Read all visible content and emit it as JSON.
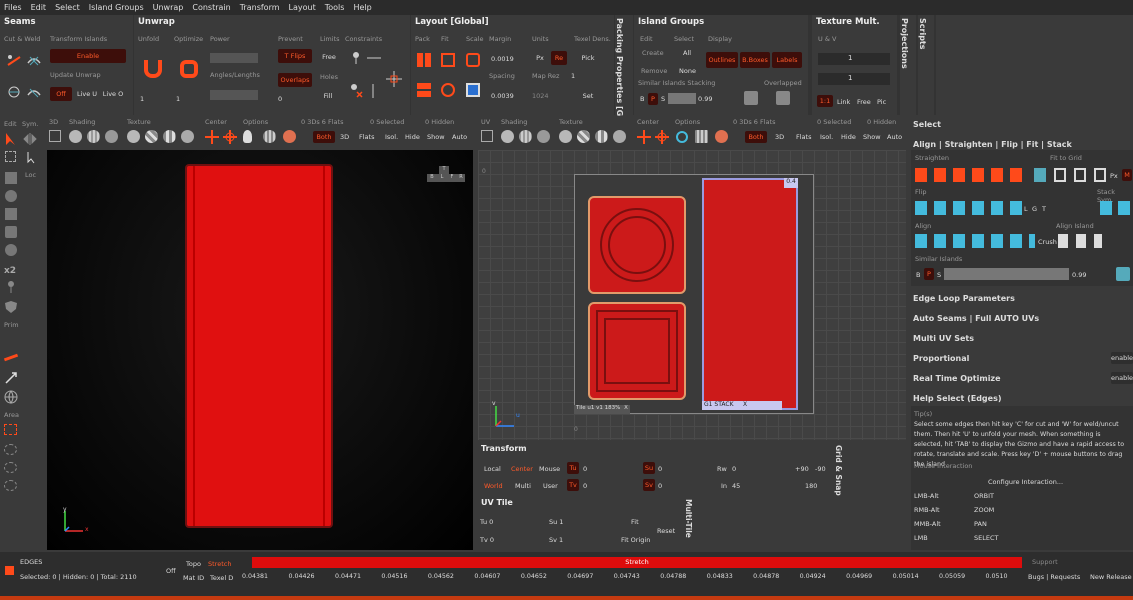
{
  "menu": [
    "Files",
    "Edit",
    "Select",
    "Island Groups",
    "Unwrap",
    "Constrain",
    "Transform",
    "Layout",
    "Tools",
    "Help"
  ],
  "seams": {
    "title": "Seams",
    "cut_weld": "Cut & Weld",
    "sym": "Sym."
  },
  "transform_islands": {
    "label": "Transform Islands",
    "enable": "Enable",
    "update_label": "Update Unwrap",
    "off": "Off",
    "live_u": "Live U",
    "live_o": "Live O"
  },
  "unwrap": {
    "title": "Unwrap",
    "unfold": "Unfold",
    "optimize": "Optimize",
    "power": "Power",
    "prevent": "Prevent",
    "limits": "Limits",
    "constraints": "Constraints",
    "t_flips": "T Flips",
    "free": "Free",
    "angles": "Angles/Lengths",
    "overlaps": "Overlaps",
    "holes": "Holes",
    "fill": "Fill",
    "v1": "1",
    "v2": "1",
    "v3": "0"
  },
  "layout": {
    "title": "Layout [Global]",
    "pack": "Pack",
    "fit": "Fit",
    "scale": "Scale",
    "margin": "Margin",
    "units": "Units",
    "texel": "Texel Dens.",
    "margin_val": "0.0019",
    "px": "Px",
    "re": "Re",
    "pick": "Pick",
    "spacing": "Spacing",
    "map_rez": "Map Rez",
    "spacing_val": "0.0039",
    "map_val": "1024",
    "set": "Set",
    "one": "1"
  },
  "packing_tab": "Packing Properties [Glo",
  "island_groups": {
    "title": "Island Groups",
    "edit": "Edit",
    "select": "Select",
    "display": "Display",
    "create": "Create",
    "all": "All",
    "remove": "Remove",
    "none": "None",
    "outlines": "Outlines",
    "bboxes": "B.Boxes",
    "labels": "Labels",
    "stacking": "Similar Islands Stacking",
    "overlapped": "Overlapped",
    "b": "B",
    "p": "P",
    "s": "S",
    "val": "0.99"
  },
  "texture_mult": {
    "title": "Texture Mult.",
    "uv": "U & V",
    "v1": "1",
    "v2": "1",
    "one": "1:1",
    "link": "Link",
    "free": "Free",
    "pic": "Pic"
  },
  "projections_tab": "Projections",
  "scripts_tab": "Scripts",
  "vp3d_toolbar": {
    "d3": "3D",
    "shading": "Shading",
    "texture": "Texture",
    "center": "Center",
    "options": "Options",
    "stats": "0 3Ds 6 Flats",
    "selected": "0 Selected",
    "hidden": "0 Hidden",
    "both": "Both",
    "td": "3D",
    "flats": "Flats",
    "isol": "Isol.",
    "hide": "Hide",
    "show": "Show",
    "auto": "Auto"
  },
  "left_tools": {
    "edit": "Edit",
    "sym": "Sym.",
    "loc": "Loc",
    "x2": "x2",
    "prim": "Prim",
    "area": "Area"
  },
  "uv_toolbar": {
    "uv": "UV",
    "shading": "Shading",
    "texture": "Texture",
    "center": "Center",
    "options": "Options",
    "stats": "0 3Ds 6 Flats",
    "selected": "0 Selected",
    "hidden": "0 Hidden",
    "both": "Both",
    "td": "3D",
    "flats": "Flats",
    "isol": "Isol.",
    "hide": "Hide",
    "show": "Show",
    "auto": "Auto"
  },
  "uv_view": {
    "tile_label": "Tile u1 v1 183%",
    "tile_x": "X",
    "g1": "G1",
    "stack": "STACK",
    "stack_x": "X",
    "badge": "0.4",
    "zero": "0",
    "zero2": "0",
    "axis_u": "u",
    "axis_v": "v"
  },
  "vp3d_axes": {
    "x": "x",
    "y": "y"
  },
  "vp3d_nav": {
    "b": "B",
    "l": "L",
    "f": "F",
    "r": "R",
    "t": "T"
  },
  "transform": {
    "title": "Transform",
    "local": "Local",
    "center": "Center",
    "mouse": "Mouse",
    "tu": "Tu",
    "tu_val": "0",
    "su": "Su",
    "su_val": "0",
    "rw": "Rw",
    "rw_val": "0",
    "p90": "+90",
    "m90": "-90",
    "world": "World",
    "multi": "Multi",
    "user": "User",
    "tv": "Tv",
    "tv_val": "0",
    "sv": "Sv",
    "sv_val": "0",
    "in": "In",
    "in_val": "45",
    "d180": "180"
  },
  "uv_tile": {
    "title": "UV Tile",
    "tu": "Tu 0",
    "su": "Su 1",
    "fit": "Fit",
    "tv": "Tv 0",
    "sv": "Sv 1",
    "fit_origin": "Fit Origin",
    "reset": "Reset"
  },
  "multi_tile_tab": "Multi-Tile",
  "grid_snap_tab": "Grid & Snap",
  "right_panel": {
    "select": "Select",
    "align_title": "Align | Straighten | Flip | Fit | Stack",
    "straighten": "Straighten",
    "fit_to_grid": "Fit to Grid",
    "flip": "Flip",
    "stack_sym": "Stack Sym.",
    "align": "Align",
    "align_island": "Align Island",
    "crush": "Crush",
    "similar": "Similar Islands",
    "b": "B",
    "p": "P",
    "s": "S",
    "val": "0.99",
    "px": "Px",
    "m": "M",
    "g": "G",
    "t": "T",
    "l": "L",
    "sections": [
      "Edge Loop Parameters",
      "Auto Seams | Full AUTO UVs",
      "Multi UV Sets",
      "Proportional",
      "Real Time Optimize",
      "Help Select (Edges)"
    ],
    "enable1": "enable",
    "enable2": "enable",
    "tips_label": "Tip(s)",
    "tips": "Select some edges then hit key 'C' for cut and 'W' for weld/uncut them. Then hit 'U' to unfold your mesh. When something is selected, hit 'TAB' to display the Gizmo and have a rapid access to rotate, translate and scale. Press key 'D' + mouse buttons to drag the island",
    "mouse_label": "Mouse Interaction",
    "configure": "Configure Interaction...",
    "mouse_rows": [
      [
        "LMB-Alt",
        "ORBIT"
      ],
      [
        "RMB-Alt",
        "ZOOM"
      ],
      [
        "MMB-Alt",
        "PAN"
      ],
      [
        "LMB",
        "SELECT"
      ]
    ]
  },
  "status": {
    "mode": "EDGES",
    "counts": "Selected: 0 | Hidden: 0 | Total: 2110",
    "off": "Off",
    "topo": "Topo",
    "stretch_btn": "Stretch",
    "matid": "Mat ID",
    "texel": "Texel D",
    "bar": "Stretch",
    "support": "Support",
    "bugs": "Bugs | Requests",
    "release": "New Release",
    "scale": [
      "0.04381",
      "0.04426",
      "0.04471",
      "0.04516",
      "0.04562",
      "0.04607",
      "0.04652",
      "0.04697",
      "0.04743",
      "0.04788",
      "0.04833",
      "0.04878",
      "0.04924",
      "0.04969",
      "0.05014",
      "0.05059",
      "0.0510"
    ]
  },
  "colors": {
    "accent": "#ff4a1a",
    "mesh_red": "#ee1111",
    "uv_red": "#cc1a1a"
  }
}
